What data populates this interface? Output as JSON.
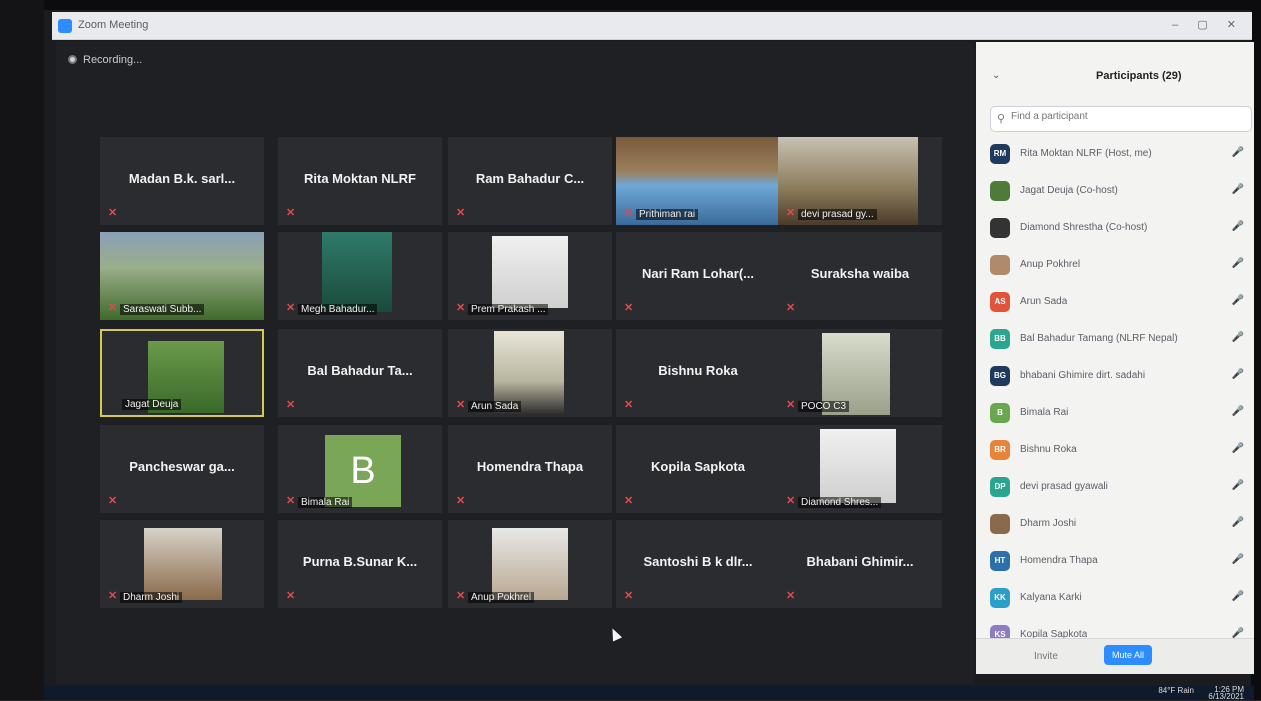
{
  "window": {
    "title": "Zoom Meeting"
  },
  "meeting": {
    "recording_label": "Recording...",
    "tiles": [
      {
        "name": "Madan B.k. sarl...",
        "video": false
      },
      {
        "name": "Rita Moktan NLRF",
        "video": false
      },
      {
        "name": "Ram Bahadur C...",
        "video": false
      },
      {
        "name": "Prithiman rai",
        "video": true
      },
      {
        "name": "devi prasad gy...",
        "video": true
      },
      {
        "name": "Saraswati Subb...",
        "video": true
      },
      {
        "name": "Megh Bahadur...",
        "video": true
      },
      {
        "name": "Prem Prakash ...",
        "video": true
      },
      {
        "name": "Nari Ram Lohar(...",
        "video": false
      },
      {
        "name": "Suraksha waiba",
        "video": false
      },
      {
        "name": "Jagat Deuja",
        "video": true,
        "active": true
      },
      {
        "name": "Bal Bahadur Ta...",
        "video": false
      },
      {
        "name": "Arun Sada",
        "video": true
      },
      {
        "name": "Bishnu Roka",
        "video": false
      },
      {
        "name": "POCO C3",
        "video": true
      },
      {
        "name": "Pancheswar ga...",
        "video": false
      },
      {
        "name": "Bimala Rai",
        "video": true,
        "avatar_letter": "B"
      },
      {
        "name": "Homendra Thapa",
        "video": false
      },
      {
        "name": "Kopila Sapkota",
        "video": false
      },
      {
        "name": "Diamond Shres...",
        "video": true
      },
      {
        "name": "Dharm Joshi",
        "video": true
      },
      {
        "name": "Purna B.Sunar K...",
        "video": false
      },
      {
        "name": "Anup Pokhrel",
        "video": true
      },
      {
        "name": "Santoshi B k dlr...",
        "video": false
      },
      {
        "name": "Bhabani Ghimir...",
        "video": false
      }
    ]
  },
  "participants": {
    "title": "Participants (29)",
    "search_placeholder": "Find a participant",
    "list": [
      {
        "initials": "RM",
        "name": "Rita Moktan NLRF (Host, me)",
        "color": "#1f3a5c"
      },
      {
        "initials": "",
        "name": "Jagat Deuja (Co-host)",
        "color": "#4e7a3a"
      },
      {
        "initials": "",
        "name": "Diamond Shrestha (Co-host)",
        "color": "#333333"
      },
      {
        "initials": "",
        "name": "Anup Pokhrel",
        "color": "#b08a6a"
      },
      {
        "initials": "AS",
        "name": "Arun Sada",
        "color": "#e2533b"
      },
      {
        "initials": "BB",
        "name": "Bal Bahadur Tamang (NLRF Nepal)",
        "color": "#2aa58f"
      },
      {
        "initials": "BG",
        "name": "bhabani Ghimire dirt. sadahi",
        "color": "#1f3a5c"
      },
      {
        "initials": "B",
        "name": "Bimala Rai",
        "color": "#6aa84f"
      },
      {
        "initials": "BR",
        "name": "Bishnu Roka",
        "color": "#e8843a"
      },
      {
        "initials": "DP",
        "name": "devi prasad gyawali",
        "color": "#2aa58f"
      },
      {
        "initials": "",
        "name": "Dharm Joshi",
        "color": "#8a6a4a"
      },
      {
        "initials": "HT",
        "name": "Homendra Thapa",
        "color": "#2d6fa8"
      },
      {
        "initials": "KK",
        "name": "Kalyana Karki",
        "color": "#2aa0c8"
      },
      {
        "initials": "KS",
        "name": "Kopila Sapkota",
        "color": "#8e7cc3"
      }
    ],
    "invite_label": "Invite",
    "mute_all_label": "Mute All"
  },
  "taskbar": {
    "weather": "84°F Rain",
    "time": "1:26 PM",
    "date": "6/13/2021"
  }
}
